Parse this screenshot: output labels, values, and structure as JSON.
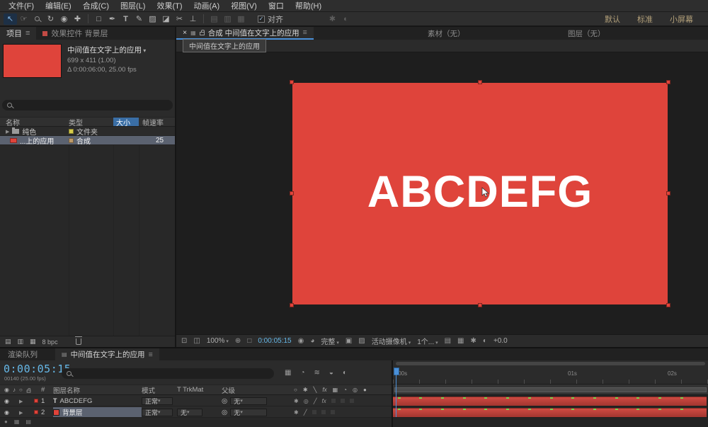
{
  "colors": {
    "accent_red": "#df443b",
    "timecode_blue": "#66b8e8",
    "selection_blue": "#4a90d9",
    "cache_green": "#7bd34f"
  },
  "menu_bar": {
    "items": [
      "文件(F)",
      "编辑(E)",
      "合成(C)",
      "图层(L)",
      "效果(T)",
      "动画(A)",
      "视图(V)",
      "窗口",
      "帮助(H)"
    ]
  },
  "toolbar": {
    "align_label": "对齐",
    "workspaces": [
      "默认",
      "标准",
      "小屏幕"
    ]
  },
  "icons": {
    "panel_menu": "≡",
    "close": "×"
  },
  "project_panel": {
    "tab_project": "项目",
    "tab_effects": "效果控件 背景层",
    "preview": {
      "comp_name": "中间值在文字上的应用",
      "dimensions": "699 x 411 (1.00)",
      "duration": "0:00:06:00, 25.00 fps"
    },
    "columns": {
      "name": "名称",
      "type": "类型",
      "size": "大小",
      "fps": "帧速率"
    },
    "rows": [
      {
        "name": "纯色",
        "type": "文件夹",
        "fps": ""
      },
      {
        "name": "...上的应用",
        "type": "合成",
        "fps": "25"
      }
    ],
    "footer_bpc": "8 bpc"
  },
  "viewer": {
    "tab_comp": "合成 中间值在文字上的应用",
    "tab_footage": "素材（无）",
    "tab_layer": "图层（无）",
    "breadcrumb": "中间值在文字上的应用",
    "canvas_text": "ABCDEFG",
    "statusbar": {
      "zoom": "100%",
      "timecode": "0:00:05:15",
      "resolution": "完整",
      "camera": "活动摄像机",
      "views": "1个...",
      "exposure": "+0.0"
    }
  },
  "timeline": {
    "tab_render_queue": "渲染队列",
    "tab_comp": "中间值在文字上的应用",
    "timecode": "0:00:05:15",
    "frame_info": "00140 (25.00 fps)",
    "columns": {
      "num": "#",
      "layer_name": "图层名称",
      "mode": "模式",
      "trkmat": "T TrkMat",
      "parent": "父级"
    },
    "layers": [
      {
        "num": "1",
        "name": "ABCDEFG",
        "mode": "正常",
        "trkmat": "",
        "parent": "无"
      },
      {
        "num": "2",
        "name": "背景层",
        "mode": "正常",
        "trkmat": "无",
        "parent": "无"
      }
    ],
    "ruler_labels": [
      ":00s",
      "01s",
      "02s"
    ],
    "cache_mark_count": 14
  }
}
